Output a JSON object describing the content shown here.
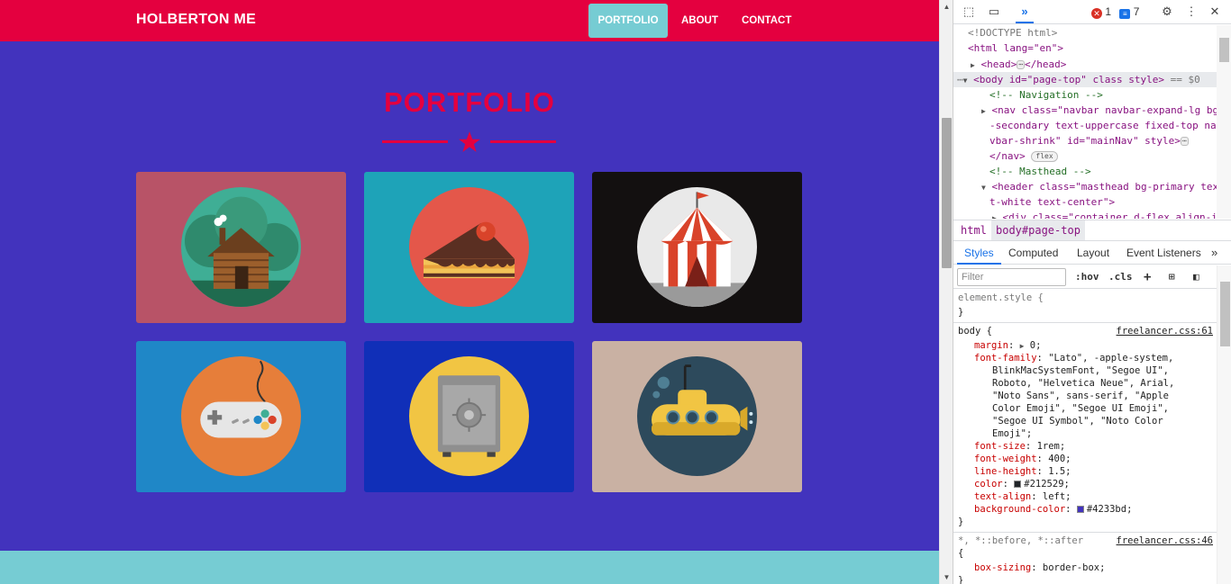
{
  "site": {
    "brand": "HOLBERTON ME",
    "nav": [
      {
        "label": "PORTFOLIO",
        "active": true
      },
      {
        "label": "ABOUT",
        "active": false
      },
      {
        "label": "CONTACT",
        "active": false
      }
    ],
    "heading": "PORTFOLIO",
    "colors": {
      "primary_bg": "#4233bd",
      "navbar": "#e4003f",
      "accent": "#76ccd3",
      "heading": "#e4003f"
    },
    "tiles": [
      {
        "name": "cabin",
        "bg": "#b85367",
        "icon": "log-cabin-icon"
      },
      {
        "name": "cake",
        "bg": "#1ea3b8",
        "icon": "cake-icon"
      },
      {
        "name": "circus",
        "bg": "#131010",
        "icon": "circus-tent-icon"
      },
      {
        "name": "game",
        "bg": "#1f87c7",
        "icon": "game-controller-icon"
      },
      {
        "name": "safe",
        "bg": "#102fb8",
        "icon": "safe-icon"
      },
      {
        "name": "submarine",
        "bg": "#c9b1a3",
        "icon": "submarine-icon"
      }
    ]
  },
  "devtools": {
    "toolbar": {
      "error_count": "1",
      "message_count": "7",
      "icons": [
        "inspect-icon",
        "device-toggle-icon",
        "more-tabs-icon",
        "settings-icon",
        "kebab-menu-icon",
        "close-icon"
      ]
    },
    "elements": {
      "doctype": "<!DOCTYPE html>",
      "html_open": "<html lang=\"en\">",
      "head": "<head>",
      "head_close": "</head>",
      "body_tag": "<body id=\"page-top\" class style>",
      "body_eq": "== $0",
      "comment_nav": "<!-- Navigation -->",
      "nav_1": "<nav class=\"navbar navbar-expand-lg bg",
      "nav_2": "-secondary text-uppercase fixed-top na",
      "nav_3": "vbar-shrink\" id=\"mainNav\" style>",
      "nav_close": "</nav>",
      "flex_badge": "flex",
      "comment_masthead": "<!-- Masthead -->",
      "header_1": "<header class=\"masthead bg-primary tex",
      "header_2": "t-white text-center\">",
      "div_partial": "<div class=\"container d-flex align-i"
    },
    "breadcrumb": [
      "html",
      "body#page-top"
    ],
    "tabs": [
      "Styles",
      "Computed",
      "Layout",
      "Event Listeners"
    ],
    "filter_placeholder": "Filter",
    "filter_buttons": [
      ":hov",
      ".cls"
    ],
    "styles": {
      "element_style": "element.style {",
      "close_brace": "}",
      "body_selector": "body {",
      "body_source": "freelancer.css:61",
      "margin_prop": "margin",
      "margin_val": "0;",
      "ff_prop": "font-family",
      "ff_val_1": "\"Lato\", -apple-system,",
      "ff_val_2": "BlinkMacSystemFont, \"Segoe UI\",",
      "ff_val_3": "Roboto, \"Helvetica Neue\", Arial,",
      "ff_val_4": "\"Noto Sans\", sans-serif, \"Apple",
      "ff_val_5": "Color Emoji\", \"Segoe UI Emoji\",",
      "ff_val_6": "\"Segoe UI Symbol\", \"Noto Color",
      "ff_val_7": "Emoji\";",
      "fs_prop": "font-size",
      "fs_val": "1rem;",
      "fw_prop": "font-weight",
      "fw_val": "400;",
      "lh_prop": "line-height",
      "lh_val": "1.5;",
      "color_prop": "color",
      "color_val": "#212529;",
      "color_swatch": "#212529",
      "ta_prop": "text-align",
      "ta_val": "left;",
      "bg_prop": "background-color",
      "bg_val": "#4233bd;",
      "bg_swatch": "#4233bd",
      "universal_selector": "*, *::before, *::after",
      "universal_source": "freelancer.css:46",
      "open_brace": "{",
      "bs_prop": "box-sizing",
      "bs_val": "border-box;"
    }
  }
}
